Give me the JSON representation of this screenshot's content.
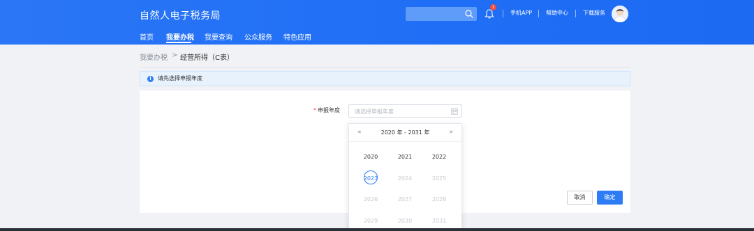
{
  "header": {
    "brand": "自然人电子税务局",
    "search_placeholder": "",
    "notification_count": "1",
    "links": [
      "手机APP",
      "帮助中心",
      "下载服务"
    ]
  },
  "nav": {
    "items": [
      "首页",
      "我要办税",
      "我要查询",
      "公众服务",
      "特色应用"
    ],
    "active": "我要办税"
  },
  "breadcrumb": {
    "parent": "我要办税",
    "separator": ">",
    "current": "经营所得（C表）"
  },
  "alert": {
    "icon": "info-icon",
    "text": "请先选择申报年度"
  },
  "form": {
    "required_mark": "*",
    "year_label": "申报年度",
    "year_placeholder": "请选择申报年度"
  },
  "buttons": {
    "cancel": "取消",
    "confirm": "确定"
  },
  "year_picker": {
    "prev_label": "«",
    "next_label": "»",
    "range_title": "2020 年 - 2031 年",
    "years": [
      {
        "label": "2020",
        "state": "enabled"
      },
      {
        "label": "2021",
        "state": "enabled"
      },
      {
        "label": "2022",
        "state": "enabled"
      },
      {
        "label": "2023",
        "state": "current"
      },
      {
        "label": "2024",
        "state": "disabled"
      },
      {
        "label": "2025",
        "state": "disabled"
      },
      {
        "label": "2026",
        "state": "disabled"
      },
      {
        "label": "2027",
        "state": "disabled"
      },
      {
        "label": "2028",
        "state": "disabled"
      },
      {
        "label": "2029",
        "state": "disabled"
      },
      {
        "label": "2030",
        "state": "disabled"
      },
      {
        "label": "2031",
        "state": "disabled"
      }
    ]
  },
  "colors": {
    "header_blue": "#1f6ef5",
    "primary": "#2d7cf6",
    "required_red": "#f24c3d",
    "page_bg": "#f0f2f5"
  }
}
